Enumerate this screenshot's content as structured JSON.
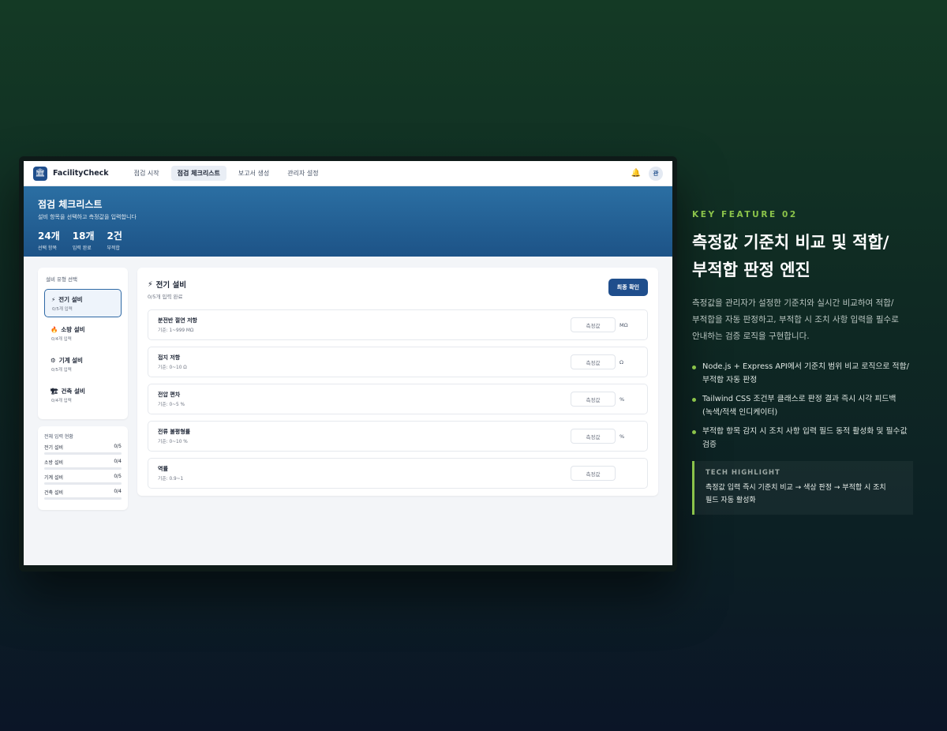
{
  "app": {
    "brand": "FacilityCheck",
    "nav": [
      "점검 시작",
      "점검 체크리스트",
      "보고서 생성",
      "관리자 설정"
    ],
    "avatar": "관"
  },
  "hero": {
    "title": "점검 체크리스트",
    "subtitle": "설비 항목을 선택하고 측정값을 입력합니다",
    "stats": [
      {
        "value": "24개",
        "label": "선택 항목"
      },
      {
        "value": "18개",
        "label": "입력 완료"
      },
      {
        "value": "2건",
        "label": "부적합"
      }
    ]
  },
  "sidebar": {
    "heading": "설비 유형 선택",
    "categories": [
      {
        "icon": "⚡",
        "name": "전기 설비",
        "count": "0/5개 입력"
      },
      {
        "icon": "🔥",
        "name": "소방 설비",
        "count": "0/4개 입력"
      },
      {
        "icon": "⚙",
        "name": "기계 설비",
        "count": "0/5개 입력"
      },
      {
        "icon": "🏗",
        "name": "건축 설비",
        "count": "0/4개 입력"
      }
    ],
    "progress_heading": "전체 입력 현황",
    "progress": [
      {
        "name": "전기 설비",
        "value": "0/5",
        "fraction": 0
      },
      {
        "name": "소방 설비",
        "value": "0/4",
        "fraction": 0
      },
      {
        "name": "기계 설비",
        "value": "0/5",
        "fraction": 0
      },
      {
        "name": "건축 설비",
        "value": "0/4",
        "fraction": 0
      }
    ]
  },
  "main": {
    "icon": "⚡",
    "title": "전기 설비",
    "subtitle": "0/5개 입력 완료",
    "button": "최종 확인",
    "items": [
      {
        "name": "분전반 절연 저항",
        "std": "기준: 1~999 MΩ",
        "placeholder": "측정값",
        "unit": "MΩ"
      },
      {
        "name": "접지 저항",
        "std": "기준: 0~10 Ω",
        "placeholder": "측정값",
        "unit": "Ω"
      },
      {
        "name": "전압 편차",
        "std": "기준: 0~5 %",
        "placeholder": "측정값",
        "unit": "%"
      },
      {
        "name": "전류 불평형률",
        "std": "기준: 0~10 %",
        "placeholder": "측정값",
        "unit": "%"
      },
      {
        "name": "역률",
        "std": "기준: 0.9~1",
        "placeholder": "측정값",
        "unit": ""
      }
    ]
  },
  "feature": {
    "kicker": "KEY FEATURE 02",
    "headline_1": "측정값 기준치 비교 및 적합/",
    "headline_2": "부적합 판정 엔진",
    "desc_1": "측정값을 관리자가 설정한 기준치와 실시간 비교하여 적합/",
    "desc_2": "부적합을 자동 판정하고, 부적합 시 조치 사항 입력을 필수로",
    "desc_3": "안내하는 검증 로직을 구현합니다.",
    "bullets": [
      [
        "Node.js + Express API에서 기준치 범위 비교 로직으로 적합/",
        "부적합 자동 판정"
      ],
      [
        "Tailwind CSS 조건부 클래스로 판정 결과 즉시 시각 피드백",
        "(녹색/적색 인디케이터)"
      ],
      [
        "부적합 항목 감지 시 조치 사항 입력 필드 동적 활성화 및 필수값",
        "검증"
      ]
    ],
    "tech_label": "TECH HIGHLIGHT",
    "tech_1": "측정값 입력 즉시 기준치 비교 → 색상 판정 → 부적합 시 조치",
    "tech_2": "필드 자동 활성화"
  }
}
